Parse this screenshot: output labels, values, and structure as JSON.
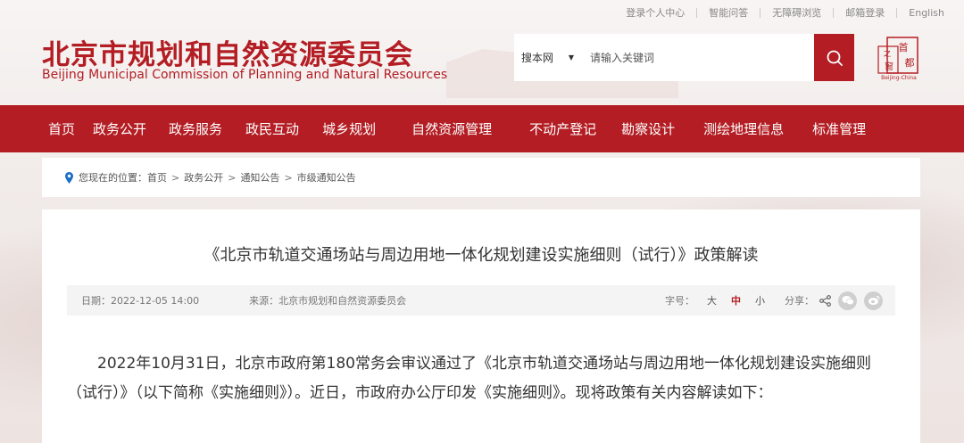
{
  "top_links": [
    "登录个人中心",
    "智能问答",
    "无障碍浏览",
    "邮箱登录",
    "English"
  ],
  "logo": {
    "cn": "北京市规划和自然资源委员会",
    "en": "Beijing Municipal Commission of Planning and Natural Resources"
  },
  "search": {
    "scope": "搜本网",
    "placeholder": "请输入关键词"
  },
  "emblem": {
    "characters": [
      "首",
      "都",
      "之",
      "窗"
    ],
    "label": "Beijing-China"
  },
  "nav": [
    "首页",
    "政务公开",
    "政务服务",
    "政民互动",
    "城乡规划",
    "自然资源管理",
    "不动产登记",
    "勘察设计",
    "测绘地理信息",
    "标准管理"
  ],
  "breadcrumb": {
    "prefix": "您现在的位置：",
    "items": [
      "首页",
      "政务公开",
      "通知公告",
      "市级通知公告"
    ],
    "separator": ">"
  },
  "article": {
    "title": "《北京市轨道交通场站与周边用地一体化规划建设实施细则（试行）》政策解读",
    "date": "日期：2022-12-05 14:00",
    "source": "来源：北京市规划和自然资源委员会",
    "font_size_label": "字号：",
    "font_sizes": [
      "大",
      "中",
      "小"
    ],
    "active_size": "中",
    "share_label": "分享：",
    "paragraph": "2022年10月31日，北京市政府第180常务会审议通过了《北京市轨道交通场站与周边用地一体化规划建设实施细则（试行）》（以下简称《实施细则》）。近日，市政府办公厅印发《实施细则》。现将政策有关内容解读如下："
  },
  "colors": {
    "brand_red": "#b31d23",
    "meta_bg": "#f4f4f4",
    "page_bg": "#f3eeec"
  }
}
